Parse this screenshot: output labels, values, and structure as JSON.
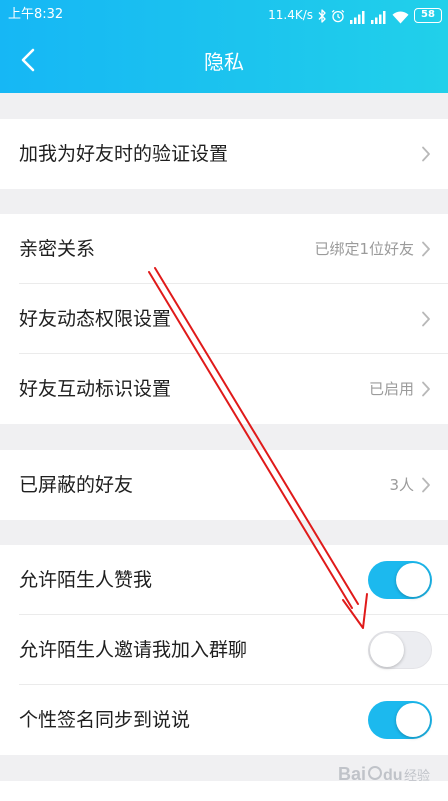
{
  "status_bar": {
    "time": "上午8:32",
    "net_speed": "11.4K/s",
    "battery": "58",
    "icons": [
      "bluetooth-icon",
      "alarm-icon",
      "signal-icon",
      "signal-icon",
      "wifi-icon",
      "battery-icon"
    ]
  },
  "header": {
    "title": "隐私",
    "back_icon": "chevron-left-icon"
  },
  "colors": {
    "header_gradient_start": "#16b7f5",
    "header_gradient_end": "#21d0ea",
    "toggle_on": "#1cb9ee",
    "toggle_off": "#ecedf1",
    "annotation_arrow": "#e01a1a",
    "page_background": "#f0f0f2"
  },
  "sections": [
    {
      "items": [
        {
          "label": "加我为好友时的验证设置",
          "value": "",
          "control": "chevron"
        }
      ]
    },
    {
      "items": [
        {
          "label": "亲密关系",
          "value": "已绑定1位好友",
          "control": "chevron"
        },
        {
          "label": "好友动态权限设置",
          "value": "",
          "control": "chevron"
        },
        {
          "label": "好友互动标识设置",
          "value": "已启用",
          "control": "chevron"
        }
      ]
    },
    {
      "items": [
        {
          "label": "已屏蔽的好友",
          "value": "3人",
          "control": "chevron"
        }
      ]
    },
    {
      "items": [
        {
          "label": "允许陌生人赞我",
          "control": "toggle",
          "checked": true
        },
        {
          "label": "允许陌生人邀请我加入群聊",
          "control": "toggle",
          "checked": false
        },
        {
          "label": "个性签名同步到说说",
          "control": "toggle",
          "checked": true
        }
      ]
    }
  ],
  "watermark": {
    "logo": "Bai du 经验"
  }
}
